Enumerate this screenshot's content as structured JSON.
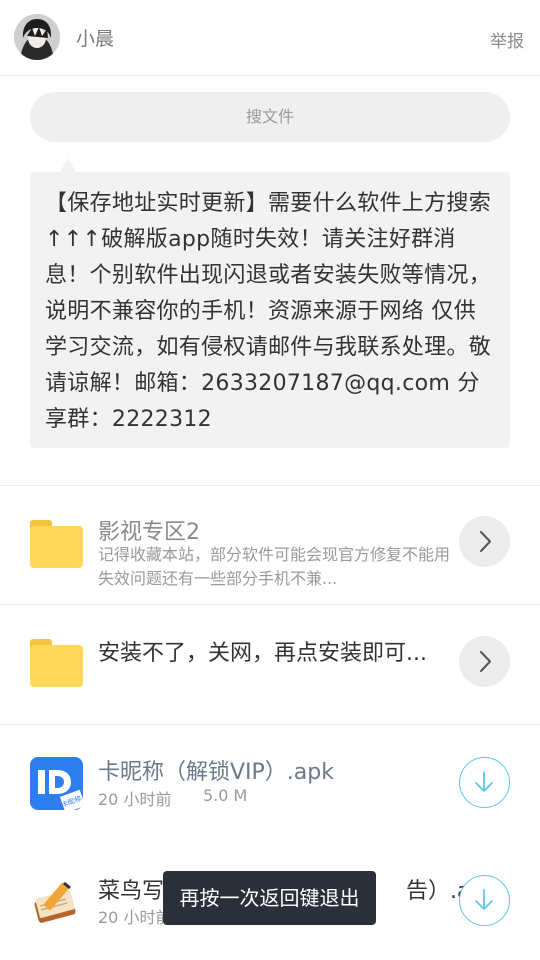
{
  "header": {
    "username": "小晨",
    "report_label": "举报"
  },
  "search": {
    "placeholder": "搜文件"
  },
  "notice": {
    "text": "【保存地址实时更新】需要什么软件上方搜索↑↑↑破解版app随时失效！请关注好群消息！个别软件出现闪退或者安装失败等情况，说明不兼容你的手机！资源来源于网络 仅供学习交流，如有侵权请邮件与我联系处理。敬请谅解！邮箱：2633207187@qq.com 分享群：2222312"
  },
  "items": [
    {
      "type": "folder",
      "title": "影视专区2",
      "desc": "记得收藏本站，部分软件可能会现官方修复不能用失效问题还有一些部分手机不兼..."
    },
    {
      "type": "folder",
      "title": "安装不了，关网，再点安装即可..."
    },
    {
      "type": "file",
      "title": "卡昵称（解锁VIP）.apk",
      "time": "20 小时前",
      "size": "5.0 M",
      "icon": "nickname-app-icon",
      "icon_badge": "卡昵称"
    },
    {
      "type": "file",
      "title": "菜鸟写",
      "title_tail": "告）.apk",
      "time": "20 小时前",
      "icon": "notebook-pencil-app-icon"
    }
  ],
  "toast": {
    "text": "再按一次返回键退出"
  },
  "colors": {
    "accent": "#5cc8e8",
    "folder": "#ffd75a",
    "app_icon_blue": "#2e7ef0",
    "toast_bg": "#2b2f3a"
  }
}
